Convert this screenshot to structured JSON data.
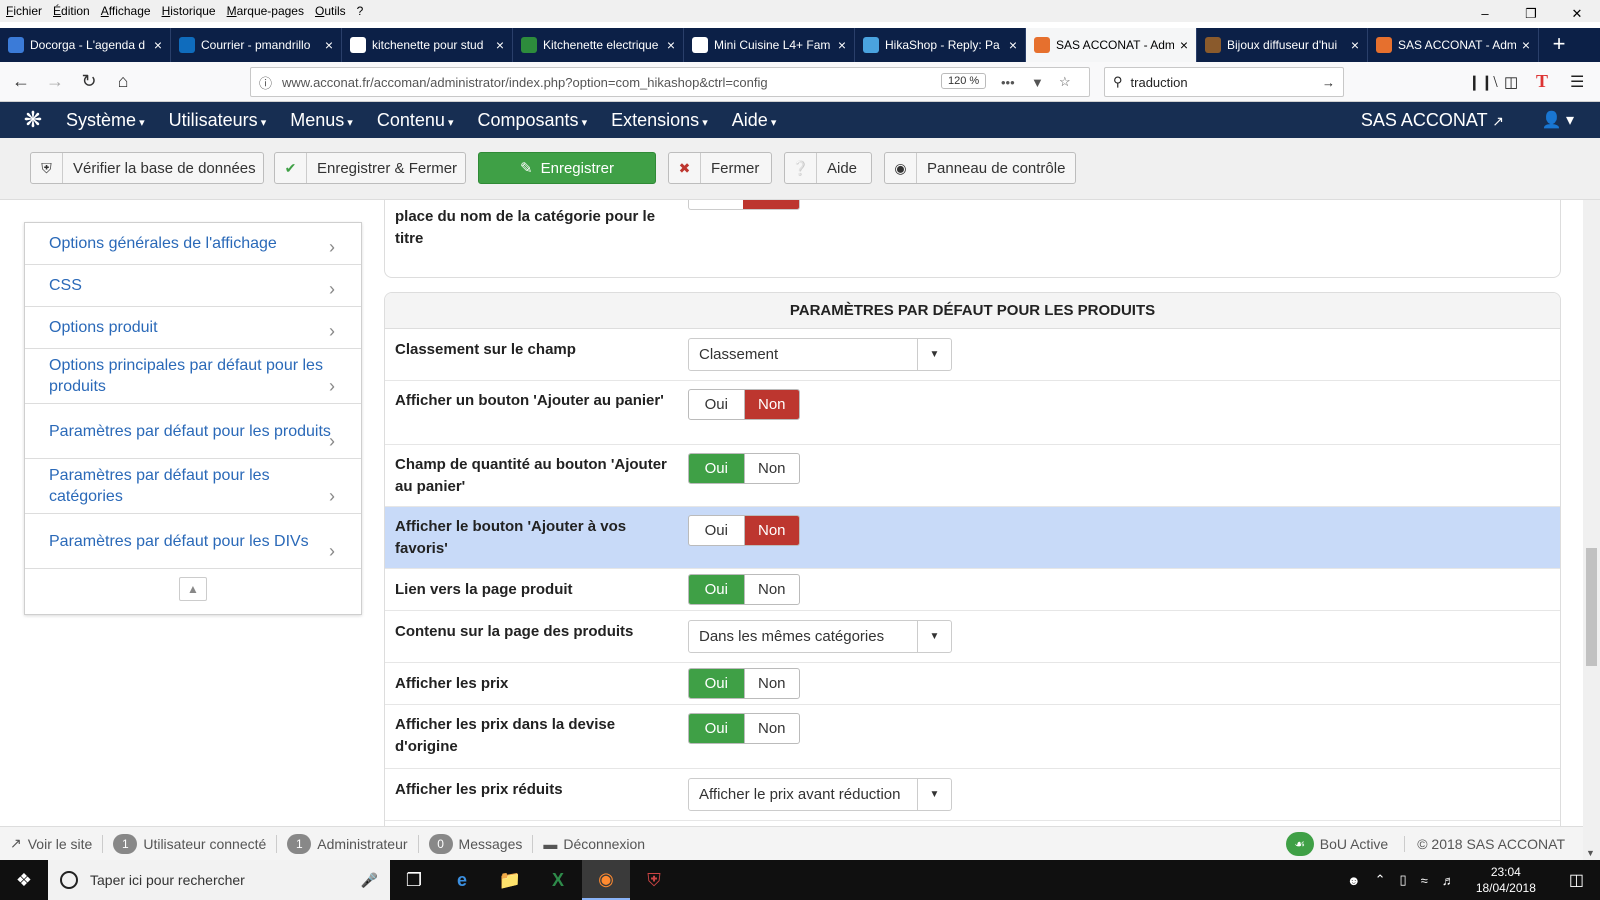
{
  "menubar": [
    "Fichier",
    "Édition",
    "Affichage",
    "Historique",
    "Marque-pages",
    "Outils",
    "?"
  ],
  "tabs": [
    {
      "title": "Docorga - L'agenda d",
      "color": "#3b7bd8"
    },
    {
      "title": "Courrier - pmandrillo",
      "color": "#0f6cbd"
    },
    {
      "title": "kitchenette pour stud",
      "color": "#ffffff"
    },
    {
      "title": "Kitchenette electrique",
      "color": "#2d8c3c"
    },
    {
      "title": "Mini Cuisine L4+ Fam",
      "color": "#ffffff"
    },
    {
      "title": "HikaShop - Reply: Pa",
      "color": "#4aa3df"
    },
    {
      "title": "SAS ACCONAT - Adm",
      "color": "#e6702e",
      "active": true
    },
    {
      "title": "Bijoux diffuseur d'hui",
      "color": "#8a5a2c"
    },
    {
      "title": "SAS ACCONAT - Adm",
      "color": "#e6702e"
    }
  ],
  "url": "www.acconat.fr/accoman/administrator/index.php?option=com_hikashop&ctrl=config",
  "zoom": "120 %",
  "search_value": "traduction",
  "joomla_menu": [
    "Système",
    "Utilisateurs",
    "Menus",
    "Contenu",
    "Composants",
    "Extensions",
    "Aide"
  ],
  "site_name": "SAS ACCONAT",
  "toolbar": {
    "verify_db": "Vérifier la base de données",
    "save_close": "Enregistrer & Fermer",
    "save": "Enregistrer",
    "close": "Fermer",
    "help": "Aide",
    "control_panel": "Panneau de contrôle"
  },
  "sidebar": [
    {
      "label": "Options générales de l'affichage"
    },
    {
      "label": "CSS"
    },
    {
      "label": "Options produit"
    },
    {
      "label": "Options principales par défaut pour les produits"
    },
    {
      "label": "Paramètres par défaut pour les produits"
    },
    {
      "label": "Paramètres par défaut pour les catégories"
    },
    {
      "label": "Paramètres par défaut pour les DIVs"
    }
  ],
  "top_panel_label": "place du nom de la catégorie pour le titre",
  "panel_title": "PARAMÈTRES PAR DÉFAUT POUR LES PRODUITS",
  "yes_label": "Oui",
  "no_label": "Non",
  "rows": [
    {
      "label": "Classement sur le champ",
      "type": "select",
      "value": "Classement"
    },
    {
      "label": "Afficher un bouton 'Ajouter au panier'",
      "type": "toggle",
      "value": "no"
    },
    {
      "label": "Champ de quantité au bouton 'Ajouter au panier'",
      "type": "toggle",
      "value": "yes"
    },
    {
      "label": "Afficher le bouton 'Ajouter à vos favoris'",
      "type": "toggle",
      "value": "no",
      "highlight": true
    },
    {
      "label": "Lien vers la page produit",
      "type": "toggle",
      "value": "yes"
    },
    {
      "label": "Contenu sur la page des produits",
      "type": "select",
      "value": "Dans les mêmes catégories"
    },
    {
      "label": "Afficher les prix",
      "type": "toggle",
      "value": "yes"
    },
    {
      "label": "Afficher les prix dans la devise d'origine",
      "type": "toggle",
      "value": "yes"
    },
    {
      "label": "Afficher les prix réduits",
      "type": "select",
      "value": "Afficher le prix avant réduction"
    }
  ],
  "status": {
    "view_site": "Voir le site",
    "users_count": "1",
    "users_label": "Utilisateur connecté",
    "admin_count": "1",
    "admin_label": "Administrateur",
    "messages_count": "0",
    "messages_label": "Messages",
    "logout": "Déconnexion",
    "bou": "BoU Active",
    "copyright": "© 2018 SAS ACCONAT"
  },
  "taskbar": {
    "search_placeholder": "Taper ici pour rechercher",
    "time": "23:04",
    "date": "18/04/2018"
  }
}
